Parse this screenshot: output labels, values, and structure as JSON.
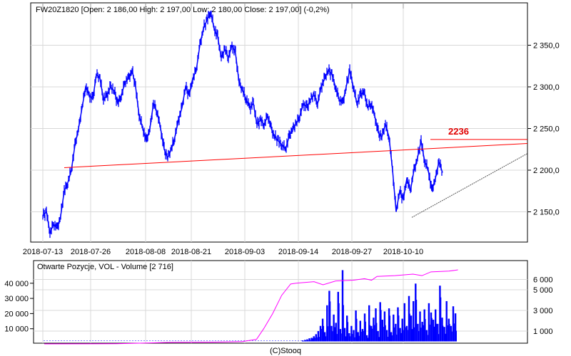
{
  "chart_data": [
    {
      "type": "line",
      "title": "FW20Z1820 [Open: 2 186,00  High: 2 197,00  Low: 2 180,00  Close: 2 197,00] (-0,2%)",
      "x_tick_labels": [
        "2018-07-13",
        "2018-07-26",
        "2018-08-08",
        "2018-08-21",
        "2018-09-03",
        "2018-09-14",
        "2018-09-27",
        "2018-10-10"
      ],
      "y_tick_labels": [
        "2 350,0",
        "2 300,0",
        "2 250,0",
        "2 200,0",
        "2 150,0"
      ],
      "y_ticks": [
        2350,
        2300,
        2250,
        2200,
        2150
      ],
      "ylim": [
        2122,
        2395
      ],
      "close": [
        2145,
        2150,
        2125,
        2135,
        2130,
        2145,
        2175,
        2185,
        2200,
        2230,
        2250,
        2275,
        2300,
        2290,
        2285,
        2315,
        2310,
        2285,
        2290,
        2300,
        2295,
        2280,
        2290,
        2305,
        2310,
        2320,
        2300,
        2265,
        2250,
        2235,
        2250,
        2280,
        2270,
        2250,
        2225,
        2215,
        2225,
        2240,
        2260,
        2275,
        2300,
        2290,
        2310,
        2320,
        2350,
        2370,
        2380,
        2390,
        2370,
        2360,
        2335,
        2345,
        2335,
        2350,
        2340,
        2305,
        2295,
        2285,
        2275,
        2280,
        2255,
        2260,
        2255,
        2265,
        2250,
        2240,
        2235,
        2230,
        2225,
        2240,
        2250,
        2255,
        2265,
        2280,
        2275,
        2285,
        2290,
        2280,
        2300,
        2310,
        2320,
        2315,
        2300,
        2285,
        2280,
        2300,
        2320,
        2300,
        2280,
        2290,
        2295,
        2275,
        2280,
        2265,
        2245,
        2240,
        2255,
        2240,
        2200,
        2150,
        2175,
        2165,
        2190,
        2175,
        2200,
        2215,
        2235,
        2210,
        2200,
        2175,
        2190,
        2210,
        2197
      ],
      "annotations": {
        "resistance_label": "2236",
        "resistance_value": 2236,
        "trend_line": [
          2203,
          2232
        ],
        "support_line": [
          2145,
          2220
        ]
      }
    },
    {
      "type": "bar",
      "title": "Otwarte Pozycje, VOL - Volume [2 716]",
      "left_tick_labels": [
        "40 000",
        "30 000",
        "20 000",
        "10 000"
      ],
      "left_ticks": [
        40000,
        30000,
        20000,
        10000
      ],
      "right_tick_labels": [
        "6 000",
        "5 000",
        "3 000",
        "1 000"
      ],
      "right_ticks": [
        6000,
        5000,
        3000,
        1000
      ],
      "volume": [
        100,
        150,
        200,
        300,
        350,
        500,
        700,
        1000,
        1500,
        2200,
        900,
        3500,
        4900,
        1500,
        2600,
        1800,
        4800,
        1200,
        6900,
        1300,
        2500,
        800,
        1500,
        1100,
        3000,
        900,
        2000,
        1200,
        2700,
        600,
        3500,
        1500,
        2300,
        3200,
        1000,
        3800,
        2100,
        2900,
        1100,
        3200,
        900,
        2600,
        1700,
        3300,
        1300,
        2200,
        3700,
        1500,
        4400,
        2500,
        3900,
        5600,
        1700,
        2900,
        1900,
        3100,
        1100,
        3700,
        2800,
        2100,
        3100,
        1700,
        5400,
        2300,
        1400,
        3900,
        2200,
        1500,
        3400,
        2716
      ],
      "open_interest": [
        {
          "x": 0,
          "v": 0
        },
        {
          "x": 40,
          "v": 100
        },
        {
          "x": 55,
          "v": 500
        },
        {
          "x": 70,
          "v": 1000
        },
        {
          "x": 95,
          "v": 1200
        },
        {
          "x": 110,
          "v": 1500
        },
        {
          "x": 118,
          "v": 3000
        },
        {
          "x": 122,
          "v": 10000
        },
        {
          "x": 127,
          "v": 20000
        },
        {
          "x": 132,
          "v": 32000
        },
        {
          "x": 137,
          "v": 39500
        },
        {
          "x": 140,
          "v": 40000
        },
        {
          "x": 150,
          "v": 41000
        },
        {
          "x": 155,
          "v": 39000
        },
        {
          "x": 162,
          "v": 41500
        },
        {
          "x": 172,
          "v": 42000
        },
        {
          "x": 178,
          "v": 43000
        },
        {
          "x": 182,
          "v": 42000
        },
        {
          "x": 185,
          "v": 44500
        },
        {
          "x": 195,
          "v": 45000
        },
        {
          "x": 205,
          "v": 46000
        },
        {
          "x": 210,
          "v": 45000
        },
        {
          "x": 215,
          "v": 47500
        },
        {
          "x": 225,
          "v": 48000
        },
        {
          "x": 230,
          "v": 48800
        }
      ]
    }
  ],
  "footer": "(C)Stooq",
  "colors": {
    "price": "#0000ff",
    "trend": "#ff0000",
    "support": "#000000",
    "volume": "#0000ff",
    "oi": "#ff00ff",
    "grid": "#d8d8d8"
  }
}
